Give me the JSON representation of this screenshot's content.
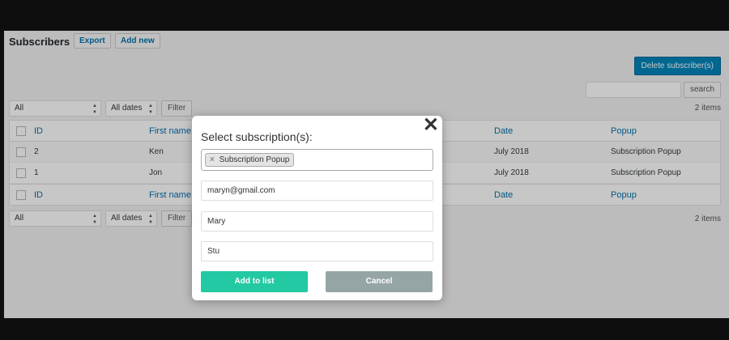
{
  "header": {
    "title": "Subscribers",
    "export_label": "Export",
    "add_new_label": "Add new"
  },
  "actions": {
    "delete_label": "Delete subscriber(s)",
    "search_label": "search",
    "search_value": ""
  },
  "filters": {
    "bulk_select": "All",
    "date_select": "All dates",
    "filter_label": "Filter",
    "items_count": "2 items"
  },
  "table": {
    "columns": [
      "ID",
      "First name",
      "Date",
      "Popup"
    ],
    "rows": [
      {
        "id": "2",
        "first_name": "Ken",
        "date": "July 2018",
        "popup": "Subscription Popup"
      },
      {
        "id": "1",
        "first_name": "Jon",
        "date": "July 2018",
        "popup": "Subscription Popup"
      }
    ]
  },
  "modal": {
    "title": "Select subscription(s):",
    "close_glyph": "✕",
    "selected_tag": "Subscription Popup",
    "tag_remove": "×",
    "email": "maryn@gmail.com",
    "first_name": "Mary",
    "last_name": "Stu",
    "add_label": "Add to list",
    "cancel_label": "Cancel"
  },
  "colors": {
    "primary": "#0085ba",
    "add_button": "#22c9a2",
    "cancel_button": "#95a5a6",
    "link": "#0073aa"
  }
}
